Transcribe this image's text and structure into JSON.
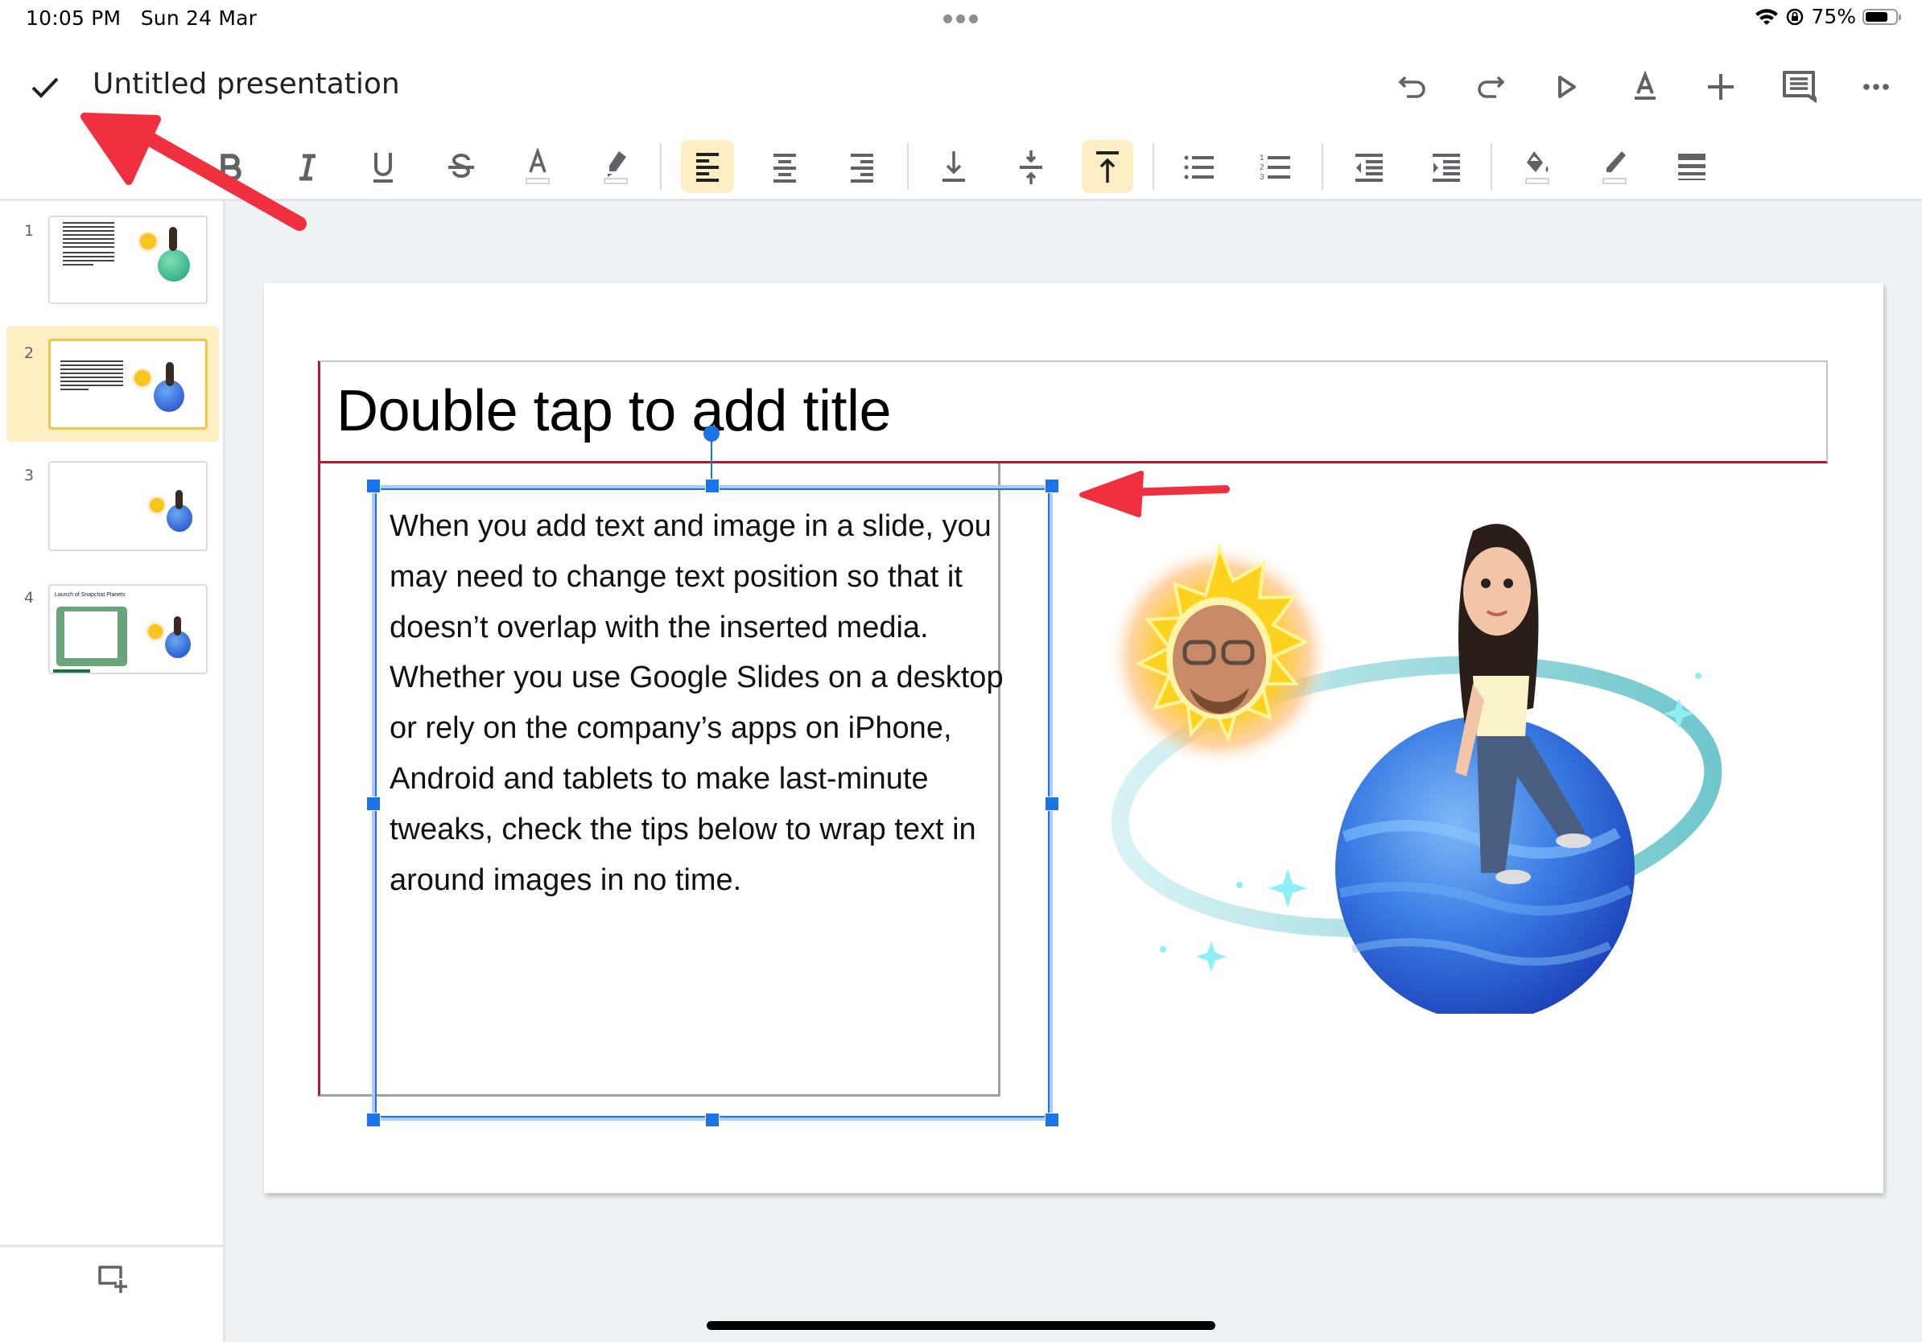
{
  "status_bar": {
    "time": "10:05 PM",
    "date": "Sun 24 Mar",
    "battery_percent_label": "75%",
    "battery_level": 0.75,
    "icons": [
      "wifi-icon",
      "orientation-lock-icon",
      "battery-icon"
    ]
  },
  "top_bar": {
    "done_icon": "checkmark-icon",
    "document_title": "Untitled presentation",
    "actions": [
      {
        "name": "undo",
        "icon": "undo-icon"
      },
      {
        "name": "redo",
        "icon": "redo-icon"
      },
      {
        "name": "present",
        "icon": "play-icon"
      },
      {
        "name": "text-format",
        "icon": "text-format-icon"
      },
      {
        "name": "insert",
        "icon": "plus-icon"
      },
      {
        "name": "comments",
        "icon": "comment-icon"
      },
      {
        "name": "more",
        "icon": "more-horizontal-icon"
      }
    ]
  },
  "format_toolbar": {
    "buttons": [
      {
        "name": "bold",
        "icon": "bold-icon",
        "active": false
      },
      {
        "name": "italic",
        "icon": "italic-icon",
        "active": false
      },
      {
        "name": "underline",
        "icon": "underline-icon",
        "active": false
      },
      {
        "name": "strikethrough",
        "icon": "strikethrough-icon",
        "active": false
      },
      {
        "name": "text-color",
        "icon": "text-color-icon",
        "active": false
      },
      {
        "name": "highlight-color",
        "icon": "highlighter-icon",
        "active": false
      },
      {
        "name": "align-left",
        "icon": "align-left-icon",
        "active": true
      },
      {
        "name": "align-center",
        "icon": "align-center-icon",
        "active": false
      },
      {
        "name": "align-right",
        "icon": "align-right-icon",
        "active": false
      },
      {
        "name": "vertical-align-bottom",
        "icon": "vertical-align-bottom-icon",
        "active": false
      },
      {
        "name": "vertical-align-middle",
        "icon": "vertical-align-middle-icon",
        "active": false
      },
      {
        "name": "vertical-align-top",
        "icon": "vertical-align-top-icon",
        "active": true
      },
      {
        "name": "bulleted-list",
        "icon": "bulleted-list-icon",
        "active": false
      },
      {
        "name": "numbered-list",
        "icon": "numbered-list-icon",
        "active": false
      },
      {
        "name": "decrease-indent",
        "icon": "decrease-indent-icon",
        "active": false
      },
      {
        "name": "increase-indent",
        "icon": "increase-indent-icon",
        "active": false
      },
      {
        "name": "fill-color",
        "icon": "fill-color-icon",
        "active": false
      },
      {
        "name": "border-color",
        "icon": "border-color-icon",
        "active": false
      },
      {
        "name": "border-weight",
        "icon": "border-weight-icon",
        "active": false
      }
    ]
  },
  "sidebar": {
    "slides": [
      {
        "number": "1",
        "selected": false,
        "thumb_title": ""
      },
      {
        "number": "2",
        "selected": true,
        "thumb_title": ""
      },
      {
        "number": "3",
        "selected": false,
        "thumb_title": ""
      },
      {
        "number": "4",
        "selected": false,
        "thumb_title": "Launch of Snapchat Planets"
      }
    ],
    "add_slide_icon": "add-slide-icon"
  },
  "slide": {
    "title_placeholder": "Double tap to add title",
    "body_lines": [
      "When you add text and image in a slide, you",
      "may need to change text position so that it",
      "doesn’t overlap with the inserted media.",
      "Whether you use Google Slides on a desktop",
      "or rely on the company’s apps on iPhone,",
      "Android and tablets to make last-minute",
      "tweaks, check the tips below to wrap text in",
      "around images in no time."
    ],
    "image": "bitmoji-sun-planet-illustration"
  },
  "annotations": {
    "arrow_color": "#f0303f",
    "arrows": [
      "arrow-to-checkmark",
      "arrow-to-text-box"
    ]
  },
  "colors": {
    "accent_selection": "#1a73e8",
    "active_button_bg": "#fdefc3",
    "icon_gray": "#5f6368",
    "placeholder_border_red": "#c8102e",
    "canvas_bg": "#eff2f4"
  }
}
